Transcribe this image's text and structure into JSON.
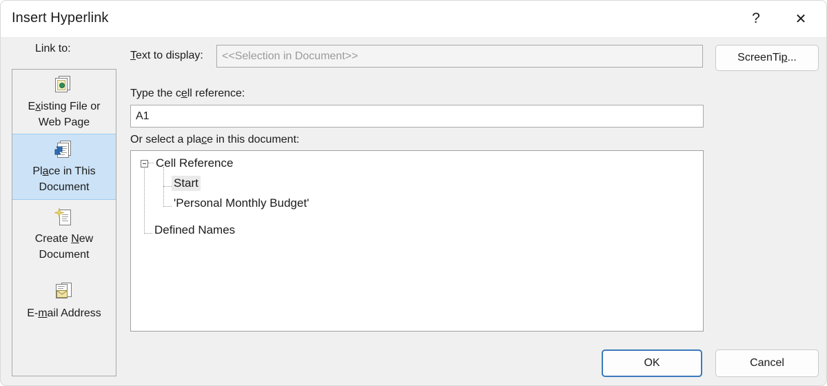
{
  "window": {
    "title": "Insert Hyperlink",
    "help_glyph": "?",
    "close_glyph": "✕"
  },
  "sidebar": {
    "heading": "Link to:",
    "items": [
      {
        "id": "existing-file-or-web-page",
        "label_pre": "E",
        "label_mnemonic": "x",
        "label_post": "isting File or\nWeb Page",
        "icon": "existing-file-web-page-icon",
        "selected": false
      },
      {
        "id": "place-in-this-document",
        "label_pre": "Pl",
        "label_mnemonic": "a",
        "label_post": "ce in This\nDocument",
        "icon": "place-in-document-icon",
        "selected": true
      },
      {
        "id": "create-new-document",
        "label_pre": "Create ",
        "label_mnemonic": "N",
        "label_post": "ew\nDocument",
        "icon": "create-new-document-icon",
        "selected": false
      },
      {
        "id": "e-mail-address",
        "label_pre": "E-",
        "label_mnemonic": "m",
        "label_post": "ail Address",
        "icon": "email-address-icon",
        "selected": false
      }
    ]
  },
  "main": {
    "text_to_display": {
      "label_pre": "",
      "label_mnemonic": "T",
      "label_post": "ext to display:",
      "value": "<<Selection in Document>>",
      "disabled": true
    },
    "screentip_button": {
      "label_pre": "ScreenTi",
      "label_mnemonic": "p",
      "label_post": "..."
    },
    "cell_reference": {
      "label_pre": "Type the c",
      "label_mnemonic": "e",
      "label_post": "ll reference:",
      "value": "A1",
      "placeholder": ""
    },
    "tree_label": {
      "label_pre": "Or select a pla",
      "label_mnemonic": "c",
      "label_post": "e in this document:"
    },
    "tree": [
      {
        "id": "cell-reference",
        "label": "Cell Reference",
        "level": 0,
        "expanded": true,
        "selected": false
      },
      {
        "id": "start",
        "label": "Start",
        "level": 1,
        "expanded": null,
        "selected": true
      },
      {
        "id": "personal-monthly-budget",
        "label": "'Personal Monthly Budget'",
        "level": 1,
        "expanded": null,
        "selected": false
      },
      {
        "id": "defined-names",
        "label": "Defined Names",
        "level": 0,
        "expanded": null,
        "selected": false
      }
    ]
  },
  "footer": {
    "ok_label": "OK",
    "cancel_label": "Cancel"
  },
  "colors": {
    "dialog_bg": "#f0f0f0",
    "titlebar_bg": "#ffffff",
    "selection_bg": "#cce3f7",
    "default_button_border": "#3a79bd",
    "tree_selection_bg": "#eaeaea",
    "muted_text": "#9b9b9b"
  }
}
